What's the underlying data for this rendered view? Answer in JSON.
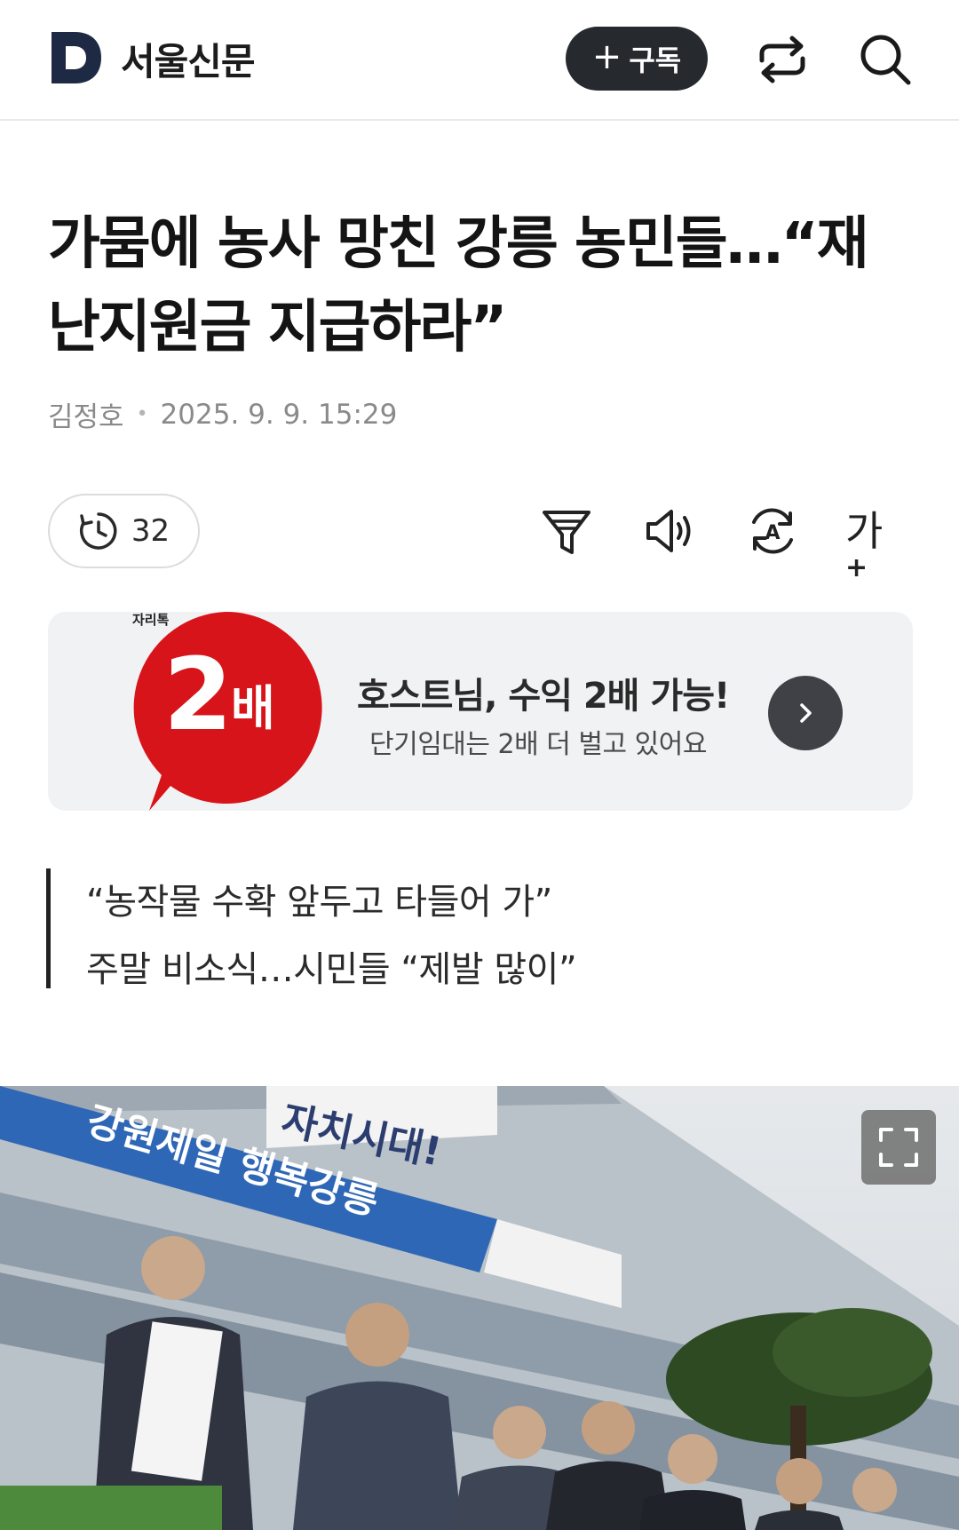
{
  "header": {
    "logo_text": "서울신문",
    "subscribe_label": "구독",
    "icons": [
      "logo-d-icon",
      "share-icon",
      "search-icon"
    ]
  },
  "article": {
    "headline_line1": "가뭄에 농사 망친 강릉 농민들…“재",
    "headline_line2": "난지원금 지급하라”",
    "author": "김정호",
    "date": "2025. 9. 9. 15:29",
    "view_count": "32",
    "tools": [
      "summary-icon",
      "listen-icon",
      "translate-icon",
      "font-size-icon"
    ],
    "font_size_label": "가",
    "font_size_plus": "+",
    "subheads": [
      "“농작물 수확 앞두고 타들어 가”",
      "주말 비소식…시민들 “제발 많이”"
    ]
  },
  "ad": {
    "brand_small": "자리톡",
    "badge_number": "2",
    "badge_suffix": "배",
    "title": "호스트님, 수익 2배 가능!",
    "subtitle": "단기임대는 2배 더 벌고 있어요",
    "accent_color": "#d7141a"
  },
  "photo": {
    "banner_text_top": "자치시대!",
    "banner_text": "강원제일 행복강릉",
    "expand_icon": "expand-icon"
  },
  "colors": {
    "logo": "#1e2a44",
    "subscribe_bg": "#26292e",
    "ad_bg": "#f1f2f4"
  }
}
